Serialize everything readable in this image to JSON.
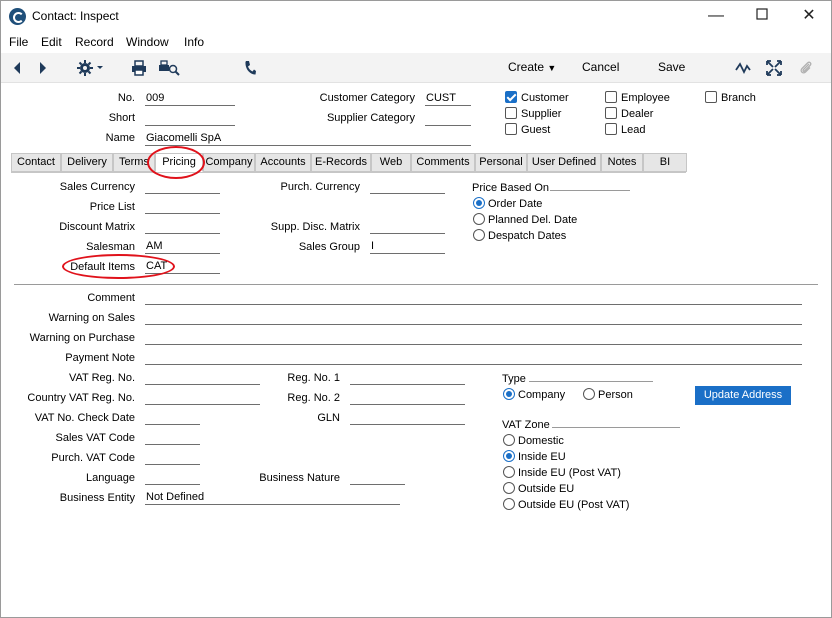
{
  "window": {
    "title": "Contact: Inspect"
  },
  "menu": [
    "File",
    "Edit",
    "Record",
    "Window",
    "Info"
  ],
  "toolbar": {
    "create": "Create",
    "cancel": "Cancel",
    "save": "Save"
  },
  "header": {
    "no_label": "No.",
    "no_value": "009",
    "short_label": "Short",
    "short_value": "",
    "name_label": "Name",
    "name_value": "Giacomelli SpA",
    "cust_cat_label": "Customer Category",
    "cust_cat_value": "CUST",
    "supp_cat_label": "Supplier Category",
    "supp_cat_value": ""
  },
  "checkboxes": [
    {
      "label": "Customer",
      "checked": true
    },
    {
      "label": "Supplier",
      "checked": false
    },
    {
      "label": "Guest",
      "checked": false
    },
    {
      "label": "Employee",
      "checked": false
    },
    {
      "label": "Dealer",
      "checked": false
    },
    {
      "label": "Lead",
      "checked": false
    },
    {
      "label": "Branch",
      "checked": false
    }
  ],
  "tabs": [
    "Contact",
    "Delivery",
    "Terms",
    "Pricing",
    "Company",
    "Accounts",
    "E-Records",
    "Web",
    "Comments",
    "Personal",
    "User Defined",
    "Notes",
    "BI"
  ],
  "active_tab": "Pricing",
  "pricing": {
    "sales_currency_label": "Sales Currency",
    "sales_currency": "",
    "price_list_label": "Price List",
    "price_list": "",
    "discount_matrix_label": "Discount Matrix",
    "discount_matrix": "",
    "salesman_label": "Salesman",
    "salesman": "AM",
    "default_items_label": "Default Items",
    "default_items": "CAT",
    "purch_currency_label": "Purch. Currency",
    "purch_currency": "",
    "supp_disc_label": "Supp. Disc. Matrix",
    "supp_disc": "",
    "sales_group_label": "Sales Group",
    "sales_group": "I",
    "price_based_on_label": "Price Based On",
    "price_based_on_options": [
      "Order Date",
      "Planned Del. Date",
      "Despatch Dates"
    ],
    "price_based_on_selected": 0
  },
  "lower": {
    "comment_label": "Comment",
    "warning_sales_label": "Warning on Sales",
    "warning_purchase_label": "Warning on Purchase",
    "payment_note_label": "Payment Note",
    "vat_reg_label": "VAT Reg. No.",
    "country_vat_label": "Country VAT Reg. No.",
    "vat_check_label": "VAT No. Check Date",
    "sales_vat_label": "Sales VAT Code",
    "purch_vat_label": "Purch. VAT Code",
    "language_label": "Language",
    "business_entity_label": "Business Entity",
    "business_entity": "Not Defined",
    "reg1_label": "Reg. No. 1",
    "reg2_label": "Reg. No. 2",
    "gln_label": "GLN",
    "business_nature_label": "Business Nature",
    "type_label": "Type",
    "type_options": [
      "Company",
      "Person"
    ],
    "type_selected": 0,
    "update_address": "Update Address",
    "vat_zone_label": "VAT Zone",
    "vat_zone_options": [
      "Domestic",
      "Inside EU",
      "Inside EU (Post VAT)",
      "Outside EU",
      "Outside EU (Post VAT)"
    ],
    "vat_zone_selected": 1
  },
  "colors": {
    "accent": "#1a6fc7",
    "highlight_circle": "#e0121b"
  }
}
